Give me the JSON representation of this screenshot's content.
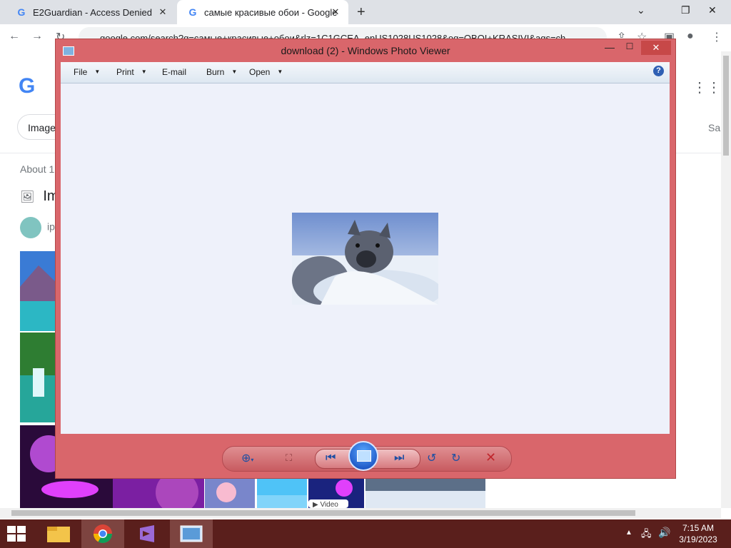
{
  "browser": {
    "tabs": [
      {
        "title": "E2Guardian - Access Denied"
      },
      {
        "title": "самые красивые обои - Google"
      }
    ],
    "new_tab": "+",
    "window_controls": {
      "minimize": "⌄",
      "restore": "❐",
      "close": "✕"
    },
    "url": "google.com/search?q=самые+красивые+обои&rlz=1C1GCEA_enUS1028US1028&oq=OBOI+KRASIVI&aqs=ch"
  },
  "google_page": {
    "images_chip": "Image",
    "about": "About 1",
    "images_heading": "Im",
    "chip": "ip",
    "right_tab_s": "s",
    "right_tab_sa": "Sa",
    "video_badge": "▶ Video"
  },
  "photo_viewer": {
    "title": "download (2) - Windows Photo Viewer",
    "menu": {
      "file": "File",
      "print": "Print",
      "email": "E-mail",
      "burn": "Burn",
      "open": "Open"
    },
    "help": "?",
    "window_controls": {
      "minimize": "—",
      "maximize": "☐",
      "close": "✕"
    }
  },
  "taskbar": {
    "clock_time": "7:15 AM",
    "clock_date": "3/19/2023"
  },
  "icons": {
    "reload": "reload-icon",
    "help": "help-icon",
    "zoom": "zoom-icon",
    "delete": "delete-icon"
  }
}
